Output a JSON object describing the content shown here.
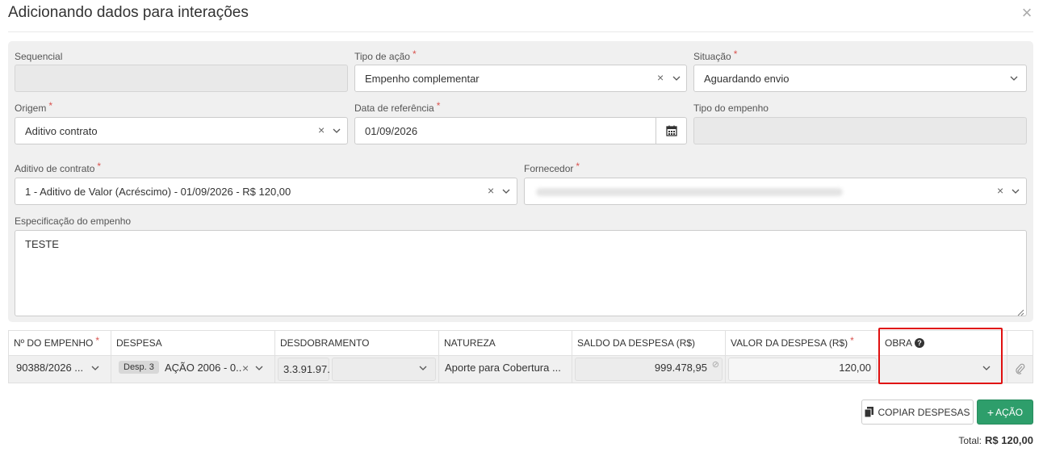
{
  "modal": {
    "title": "Adicionando dados para interações",
    "close": "×"
  },
  "form": {
    "sequencial": {
      "label": "Sequencial",
      "value": ""
    },
    "tipo_acao": {
      "label": "Tipo de ação",
      "required": "*",
      "value": "Empenho complementar"
    },
    "situacao": {
      "label": "Situação",
      "required": "*",
      "value": "Aguardando envio"
    },
    "origem": {
      "label": "Origem",
      "required": "*",
      "value": "Aditivo contrato"
    },
    "data_referencia": {
      "label": "Data de referência",
      "required": "*",
      "value": "01/09/2026"
    },
    "tipo_empenho": {
      "label": "Tipo do empenho",
      "value": ""
    },
    "aditivo_contrato": {
      "label": "Aditivo de contrato",
      "required": "*",
      "value": "1 - Aditivo de Valor (Acréscimo) - 01/09/2026 - R$ 120,00"
    },
    "fornecedor": {
      "label": "Fornecedor",
      "required": "*"
    },
    "especificacao": {
      "label": "Especificação do empenho",
      "value": "TESTE"
    },
    "clear_glyph": "×"
  },
  "table": {
    "headers": {
      "n_empenho": "Nº DO EMPENHO",
      "despesa": "DESPESA",
      "desdobramento": "DESDOBRAMENTO",
      "natureza": "NATUREZA",
      "saldo": "SALDO DA DESPESA (R$)",
      "valor": "VALOR DA DESPESA (R$)",
      "obra": "OBRA"
    },
    "required": "*",
    "help_glyph": "?",
    "row": {
      "n_empenho": "90388/2026 ...",
      "despesa_badge": "Desp. 3",
      "despesa": "AÇÃO 2006 - 0...",
      "desdobramento": "3.3.91.97.",
      "natureza": "Aporte para Cobertura ...",
      "saldo": "999.478,95",
      "valor": "120,00",
      "obra": ""
    }
  },
  "actions": {
    "copy_label": "COPIAR DESPESAS",
    "add_label": "AÇÃO",
    "add_prefix": "+"
  },
  "total": {
    "label": "Total:",
    "value": "R$ 120,00"
  },
  "colors": {
    "accent_green": "#2e9e6b",
    "required_red": "#d9534f",
    "highlight_red": "#e01010"
  }
}
